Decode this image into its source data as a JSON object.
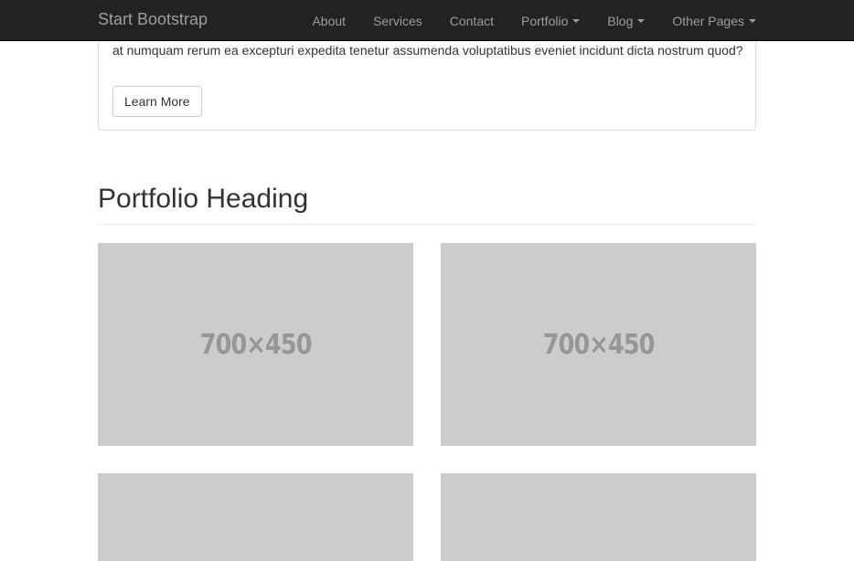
{
  "navbar": {
    "brand": "Start Bootstrap",
    "items": [
      {
        "label": "About",
        "dropdown": false
      },
      {
        "label": "Services",
        "dropdown": false
      },
      {
        "label": "Contact",
        "dropdown": false
      },
      {
        "label": "Portfolio",
        "dropdown": true
      },
      {
        "label": "Blog",
        "dropdown": true
      },
      {
        "label": "Other Pages",
        "dropdown": true
      }
    ]
  },
  "panel": {
    "text": "at numquam rerum ea excepturi expedita tenetur assumenda voluptatibus eveniet incidunt dicta nostrum quod?",
    "button_label": "Learn More"
  },
  "portfolio": {
    "heading": "Portfolio Heading",
    "thumbnails": [
      {
        "label": "700×450"
      },
      {
        "label": "700×450"
      },
      {
        "label": ""
      },
      {
        "label": ""
      }
    ]
  },
  "colors": {
    "navbar_bg": "#222222",
    "navbar_text": "#9d9d9d",
    "placeholder_bg": "#cccccc",
    "placeholder_text": "#969696"
  }
}
